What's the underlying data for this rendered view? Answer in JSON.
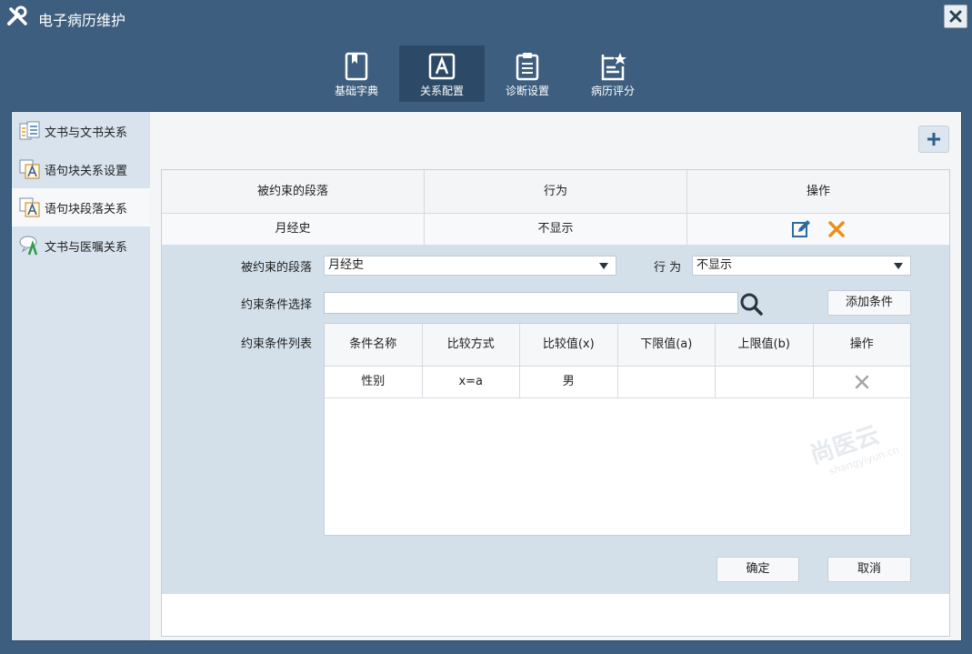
{
  "window": {
    "title": "电子病历维护"
  },
  "toolbar": {
    "items": [
      {
        "label": "基础字典",
        "icon": "book-icon",
        "active": false
      },
      {
        "label": "关系配置",
        "icon": "relation-config-icon",
        "active": true
      },
      {
        "label": "诊断设置",
        "icon": "clipboard-icon",
        "active": false
      },
      {
        "label": "病历评分",
        "icon": "star-document-icon",
        "active": false
      }
    ]
  },
  "sidebar": {
    "items": [
      {
        "label": "文书与文书关系",
        "icon": "document-list-icon"
      },
      {
        "label": "语句块关系设置",
        "icon": "sentence-block-icon"
      },
      {
        "label": "语句块段落关系",
        "icon": "sentence-block-icon",
        "active": true
      },
      {
        "label": "文书与医嘱关系",
        "icon": "order-relation-icon"
      }
    ]
  },
  "rules_table": {
    "headers": [
      "被约束的段落",
      "行为",
      "操作"
    ],
    "rows": [
      {
        "paragraph": "月经史",
        "behavior": "不显示"
      }
    ]
  },
  "edit_form": {
    "paragraph_label": "被约束的段落",
    "paragraph_value": "月经史",
    "behavior_label": "行 为",
    "behavior_value": "不显示",
    "condition_select_label": "约束条件选择",
    "condition_input_value": "",
    "add_condition_label": "添加条件",
    "condition_list_label": "约束条件列表",
    "confirm_label": "确定",
    "cancel_label": "取消"
  },
  "condition_table": {
    "headers": [
      "条件名称",
      "比较方式",
      "比较值(x)",
      "下限值(a)",
      "上限值(b)",
      "操作"
    ],
    "rows": [
      {
        "name": "性别",
        "method": "x=a",
        "value": "男",
        "lower": "",
        "upper": ""
      }
    ]
  },
  "watermark": {
    "text": "尚医云",
    "subtext": "shangyiyun.cn"
  },
  "colors": {
    "window_bg": "#3d5e7e",
    "toolbar_active": "#2c4a67",
    "sidebar_bg": "#d8e3ee",
    "edit_bg": "#d3e0ea",
    "delete_orange": "#f08c1a",
    "edit_blue": "#2f6a9e"
  }
}
